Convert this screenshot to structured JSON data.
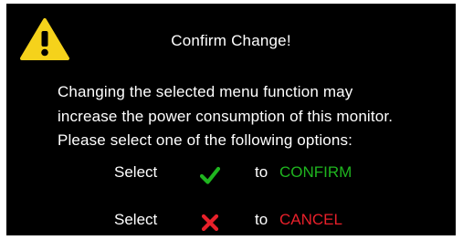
{
  "dialog": {
    "title": "Confirm Change!",
    "message_lines": [
      "Changing the selected menu function may",
      "increase the power consumption of this monitor.",
      "Please select one of the following options:"
    ],
    "options": [
      {
        "prefix": "Select",
        "icon": "checkmark-icon",
        "connector": "to",
        "action": "CONFIRM",
        "color": "#1fb51f"
      },
      {
        "prefix": "Select",
        "icon": "cross-icon",
        "connector": "to",
        "action": "CANCEL",
        "color": "#e8202a"
      }
    ]
  },
  "colors": {
    "background": "#000000",
    "text": "#ffffff",
    "warning_yellow": "#f5d21b",
    "confirm_green": "#1fb51f",
    "cancel_red": "#e8202a"
  }
}
